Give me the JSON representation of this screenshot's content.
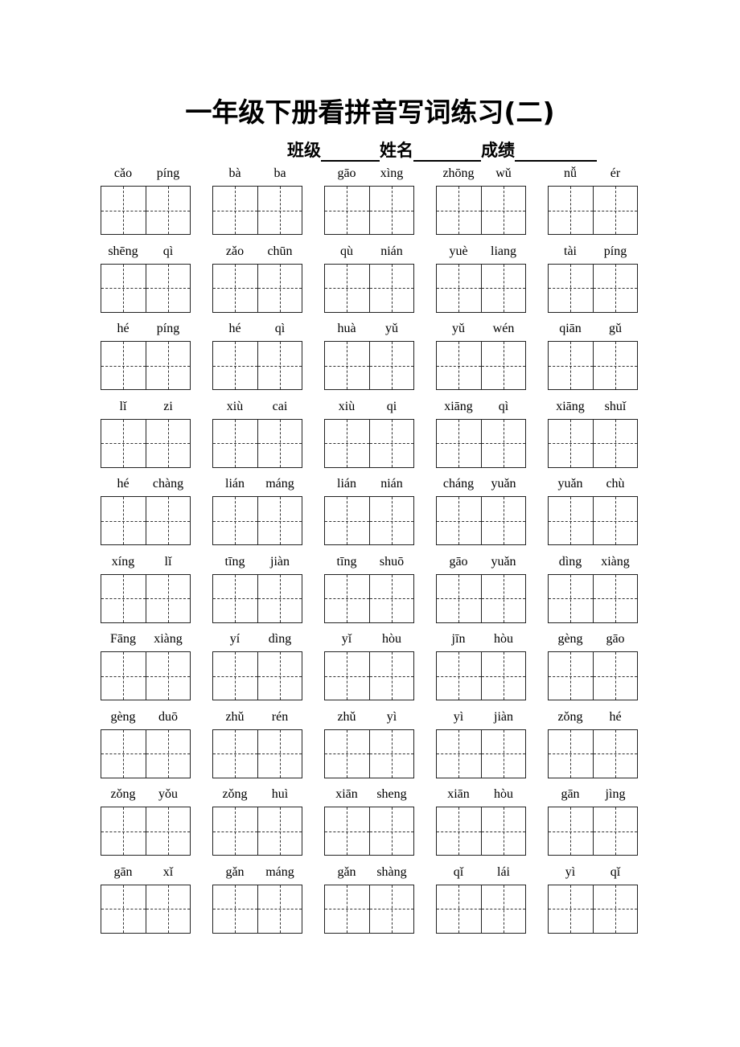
{
  "title": "一年级下册看拼音写词练习(二)",
  "info": {
    "class_label": "班级",
    "name_label": "姓名",
    "score_label": "成绩"
  },
  "rows": [
    [
      [
        "cǎo",
        "píng"
      ],
      [
        "bà",
        "ba"
      ],
      [
        "gāo",
        "xìng"
      ],
      [
        "zhōng",
        "wǔ"
      ],
      [
        "nǚ",
        "ér"
      ]
    ],
    [
      [
        "shēng",
        "qì"
      ],
      [
        "zǎo",
        "chūn"
      ],
      [
        "qù",
        "nián"
      ],
      [
        "yuè",
        "liang"
      ],
      [
        "tài",
        "píng"
      ]
    ],
    [
      [
        "hé",
        "píng"
      ],
      [
        "hé",
        "qì"
      ],
      [
        "huà",
        "yǔ"
      ],
      [
        "yǔ",
        "wén"
      ],
      [
        "qiān",
        "gǔ"
      ]
    ],
    [
      [
        "lǐ",
        "zi"
      ],
      [
        "xiù",
        "cai"
      ],
      [
        "xiù",
        "qi"
      ],
      [
        "xiāng",
        "qì"
      ],
      [
        "xiāng",
        "shuǐ"
      ]
    ],
    [
      [
        "hé",
        "chàng"
      ],
      [
        "lián",
        "máng"
      ],
      [
        "lián",
        "nián"
      ],
      [
        "cháng",
        "yuǎn"
      ],
      [
        "yuǎn",
        "chù"
      ]
    ],
    [
      [
        "xíng",
        "lǐ"
      ],
      [
        "tīng",
        "jiàn"
      ],
      [
        "tīng",
        "shuō"
      ],
      [
        "gāo",
        "yuǎn"
      ],
      [
        "dìng",
        "xiàng"
      ]
    ],
    [
      [
        "Fāng",
        "xiàng"
      ],
      [
        "yí",
        "dìng"
      ],
      [
        "yǐ",
        "hòu"
      ],
      [
        "jīn",
        "hòu"
      ],
      [
        "gèng",
        "gāo"
      ]
    ],
    [
      [
        "gèng",
        "duō"
      ],
      [
        "zhǔ",
        "rén"
      ],
      [
        "zhǔ",
        "yì"
      ],
      [
        "yì",
        "jiàn"
      ],
      [
        "zǒng",
        "hé"
      ]
    ],
    [
      [
        "zǒng",
        "yǒu"
      ],
      [
        "zǒng",
        "huì"
      ],
      [
        "xiān",
        "sheng"
      ],
      [
        "xiān",
        "hòu"
      ],
      [
        "gān",
        "jìng"
      ]
    ],
    [
      [
        "gān",
        "xǐ"
      ],
      [
        "gǎn",
        "máng"
      ],
      [
        "gǎn",
        "shàng"
      ],
      [
        "qǐ",
        "lái"
      ],
      [
        "yì",
        "qǐ"
      ]
    ]
  ]
}
